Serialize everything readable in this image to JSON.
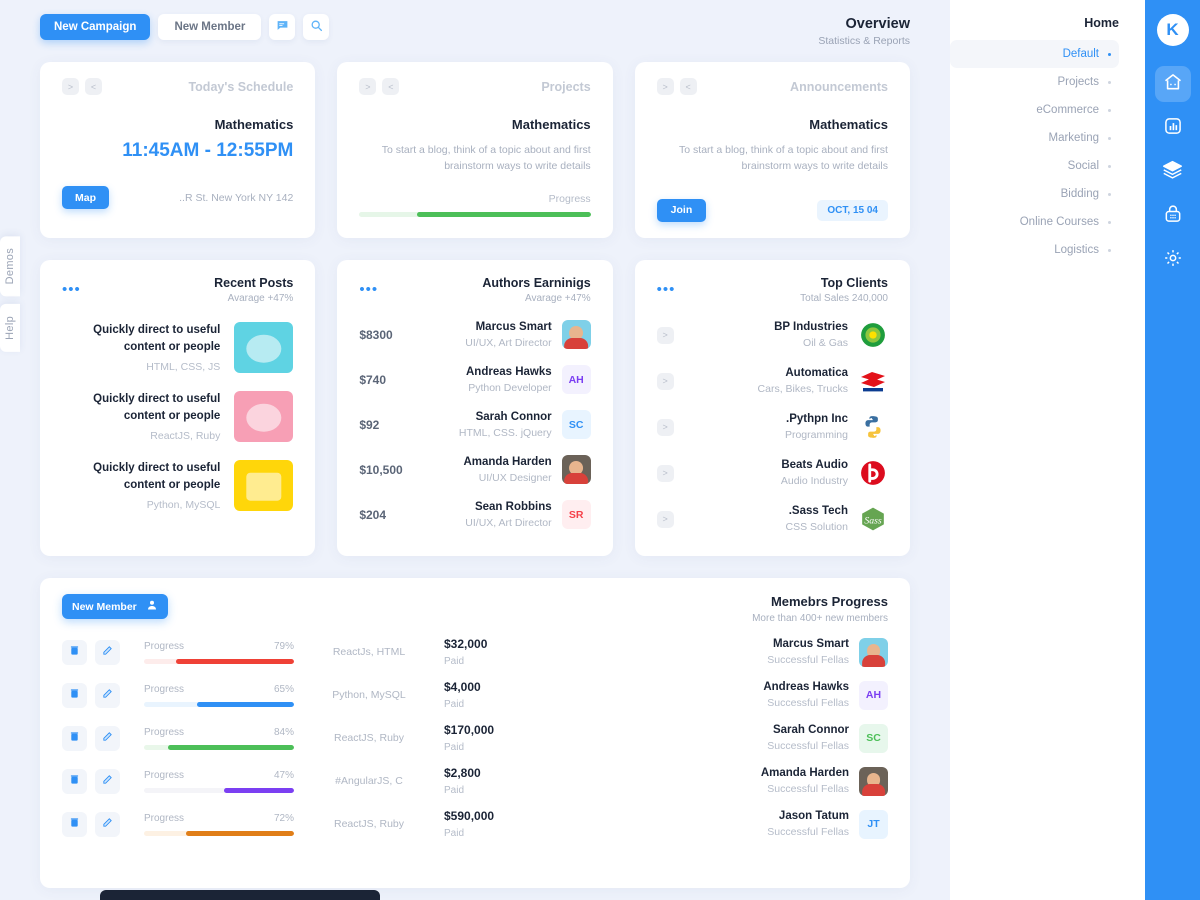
{
  "left_tabs": [
    {
      "label": "Demos"
    },
    {
      "label": "Help"
    }
  ],
  "toolbar": {
    "new_campaign": "New Campaign",
    "new_member": "New Member",
    "chat_icon": "chat-icon",
    "search_icon": "search-icon"
  },
  "header": {
    "title": "Overview",
    "subtitle": "Statistics & Reports"
  },
  "schedule_card": {
    "title": "Today's Schedule",
    "next_label": ">",
    "prev_label": "<",
    "subject": "Mathematics",
    "time": "11:45AM - 12:55PM",
    "map_button": "Map",
    "address": "..R St. New York NY 142"
  },
  "projects_card": {
    "title": "Projects",
    "next_label": ">",
    "prev_label": "<",
    "subject": "Mathematics",
    "description": "To start a blog, think of a topic about and first brainstorm ways to write details",
    "progress_label": "Progress",
    "progress_value": 75,
    "progress_color": "#4cbf58",
    "progress_track": "#e6f6e8"
  },
  "announcements_card": {
    "title": "Announcements",
    "next_label": ">",
    "prev_label": "<",
    "subject": "Mathematics",
    "description": "To start a blog, think of a topic about and first brainstorm ways to write details",
    "join_button": "Join",
    "date_badge": "OCT, 15 04"
  },
  "recent_posts": {
    "title": "Recent Posts",
    "subtitle": "Avarage +47%",
    "menu_icon": "more-dots-icon",
    "items": [
      {
        "heading": "Quickly direct to useful content or people",
        "meta": "HTML, CSS, JS",
        "thumb_color": "#5fd3e3"
      },
      {
        "heading": "Quickly direct to useful content or people",
        "meta": "ReactJS, Ruby",
        "thumb_color": "#f79fb5"
      },
      {
        "heading": "Quickly direct to useful content or people",
        "meta": "Python, MySQL",
        "thumb_color": "#ffd60a"
      }
    ]
  },
  "authors_earnings": {
    "title": "Authors Earninigs",
    "subtitle": "Avarage +47%",
    "menu_icon": "more-dots-icon",
    "items": [
      {
        "amount": "$8300",
        "name": "Marcus Smart",
        "role": "UI/UX, Art Director",
        "avatar_type": "photo",
        "avatar_bg": "#7fd0e8",
        "initials": ""
      },
      {
        "amount": "$740",
        "name": "Andreas Hawks",
        "role": "Python Developer",
        "avatar_type": "initials",
        "avatar_bg": "#f3f1fe",
        "initials": "AH",
        "initials_color": "#7b3ff2"
      },
      {
        "amount": "$92",
        "name": "Sarah Connor",
        "role": "HTML, CSS. jQuery",
        "avatar_type": "initials",
        "avatar_bg": "#e8f4ff",
        "initials": "SC",
        "initials_color": "#2f90f5"
      },
      {
        "amount": "$10,500",
        "name": "Amanda Harden",
        "role": "UI/UX Designer",
        "avatar_type": "photo",
        "avatar_bg": "#6b6258",
        "initials": ""
      },
      {
        "amount": "$204",
        "name": "Sean Robbins",
        "role": "UI/UX, Art Director",
        "avatar_type": "initials",
        "avatar_bg": "#ffeef0",
        "initials": "SR",
        "initials_color": "#f5404a"
      }
    ]
  },
  "top_clients": {
    "title": "Top Clients",
    "subtitle": "Total Sales 240,000",
    "menu_icon": "more-dots-icon",
    "arrow_label": ">",
    "items": [
      {
        "name": "BP Industries",
        "sector": "Oil & Gas",
        "logo": "bp-logo"
      },
      {
        "name": "Automatica",
        "sector": "Cars, Bikes, Trucks",
        "logo": "suzuki-logo"
      },
      {
        "name": ".Pythpn Inc",
        "sector": "Programming",
        "logo": "python-logo"
      },
      {
        "name": "Beats Audio",
        "sector": "Audio Industry",
        "logo": "beats-logo"
      },
      {
        "name": ".Sass Tech",
        "sector": "CSS Solution",
        "logo": "sass-logo"
      }
    ]
  },
  "members_panel": {
    "new_member_button": "New Member",
    "user_icon": "user-icon",
    "title": "Memebrs Progress",
    "subtitle": "More than 400+ new members",
    "delete_icon": "trash-icon",
    "edit_icon": "edit-icon",
    "progress_label": "Progress",
    "paid_label": "Paid",
    "rows": [
      {
        "percent": "79%",
        "value": 79,
        "color": "#ef4136",
        "track": "#fdeceb",
        "tech": "ReactJs, HTML",
        "paid": "$32,000",
        "name": "Marcus Smart",
        "role": "Successful Fellas",
        "avatar_type": "photo",
        "avatar_bg": "#7fd0e8",
        "initials": ""
      },
      {
        "percent": "65%",
        "value": 65,
        "color": "#2f90f5",
        "track": "#e9f4fe",
        "tech": "Python, MySQL",
        "paid": "$4,000",
        "name": "Andreas Hawks",
        "role": "Successful Fellas",
        "avatar_type": "initials",
        "avatar_bg": "#f3f1fe",
        "initials": "AH",
        "initials_color": "#7b3ff2"
      },
      {
        "percent": "84%",
        "value": 84,
        "color": "#4cbf58",
        "track": "#e9f7ea",
        "tech": "ReactJS, Ruby",
        "paid": "$170,000",
        "name": "Sarah Connor",
        "role": "Successful Fellas",
        "avatar_type": "initials",
        "avatar_bg": "#e7f7ec",
        "initials": "SC",
        "initials_color": "#4cbf58"
      },
      {
        "percent": "47%",
        "value": 47,
        "color": "#7b3ff2",
        "track": "#f4f4f8",
        "tech": "#AngularJS, C",
        "paid": "$2,800",
        "name": "Amanda Harden",
        "role": "Successful Fellas",
        "avatar_type": "photo",
        "avatar_bg": "#6b6258",
        "initials": ""
      },
      {
        "percent": "72%",
        "value": 72,
        "color": "#e07e18",
        "track": "#fdf1e3",
        "tech": "ReactJS, Ruby",
        "paid": "$590,000",
        "name": "Jason Tatum",
        "role": "Successful Fellas",
        "avatar_type": "initials",
        "avatar_bg": "#e8f4ff",
        "initials": "JT",
        "initials_color": "#2f90f5"
      }
    ]
  },
  "right_menu": {
    "home_label": "Home",
    "items": [
      {
        "label": "Default",
        "active": true
      },
      {
        "label": "Projects",
        "active": false
      },
      {
        "label": "eCommerce",
        "active": false
      },
      {
        "label": "Marketing",
        "active": false
      },
      {
        "label": "Social",
        "active": false
      },
      {
        "label": "Bidding",
        "active": false
      },
      {
        "label": "Online Courses",
        "active": false
      },
      {
        "label": "Logistics",
        "active": false
      }
    ]
  },
  "rail": {
    "logo_letter": "K",
    "icons": [
      {
        "name": "home-icon",
        "active": true
      },
      {
        "name": "chart-icon",
        "active": false
      },
      {
        "name": "layers-icon",
        "active": false
      },
      {
        "name": "basket-icon",
        "active": false
      },
      {
        "name": "settings-icon",
        "active": false
      }
    ]
  },
  "colors": {
    "accent": "#2f90f5",
    "page_bg": "#eef2fb",
    "card_bg": "#ffffff"
  }
}
